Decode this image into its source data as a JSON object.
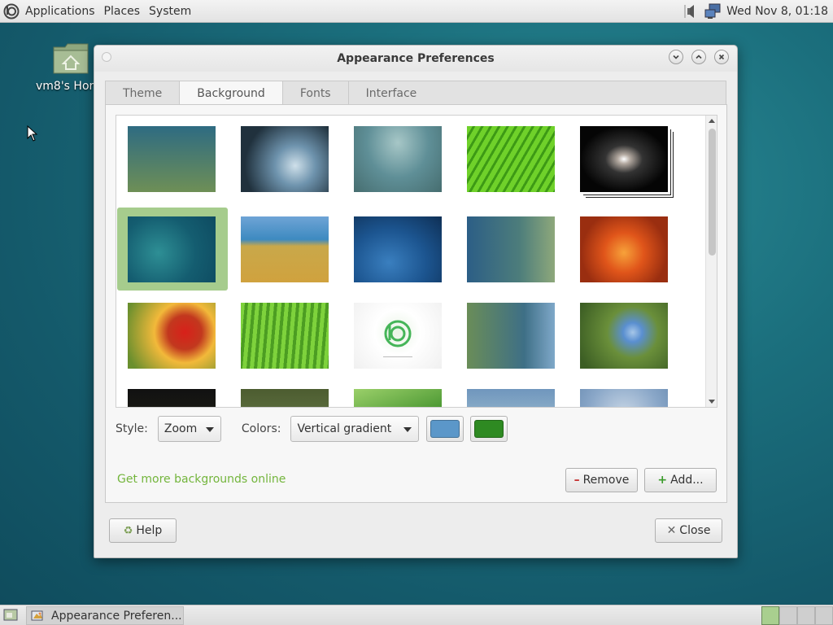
{
  "panel": {
    "menu": [
      "Applications",
      "Places",
      "System"
    ],
    "clock": "Wed Nov  8, 01:18"
  },
  "desktop": {
    "home_icon_label": "vm8's Hor"
  },
  "dialog": {
    "title": "Appearance Preferences",
    "tabs": [
      "Theme",
      "Background",
      "Fonts",
      "Interface"
    ],
    "active_tab": "Background",
    "style_label": "Style:",
    "style_value": "Zoom",
    "colors_label": "Colors:",
    "colors_value": "Vertical gradient",
    "primary_color": "#5b97c9",
    "secondary_color": "#2e8a22",
    "more_link": "Get more backgrounds online",
    "remove_button": "Remove",
    "add_button": "Add...",
    "help_button": "Help",
    "close_button": "Close"
  },
  "wallpapers": [
    "teal-green gradient",
    "water droplet",
    "blue fog",
    "green leaf",
    "sombrero galaxy",
    "teal bubbles (selected)",
    "grass by sea",
    "blue water drops",
    "blue-green bubbles",
    "orange flower",
    "orange red flower",
    "green grass",
    "logo on white",
    "blue-green wave",
    "blue flowers",
    "dark",
    "dark green",
    "green leaves",
    "blue landscape",
    "frost"
  ],
  "taskbar": {
    "task_label": "Appearance Preferen..."
  }
}
